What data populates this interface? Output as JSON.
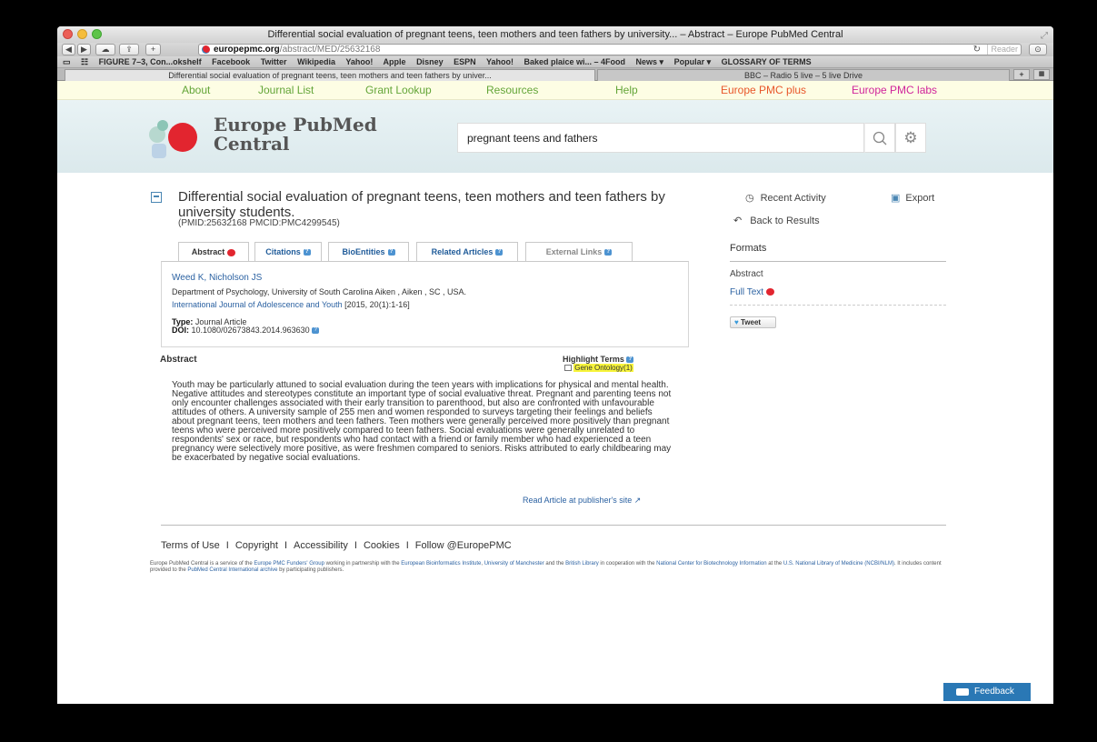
{
  "browser": {
    "window_title": "Differential social evaluation of pregnant teens, teen mothers and teen fathers by university... – Abstract – Europe PubMed Central",
    "url_host": "europepmc.org",
    "url_path": "/abstract/MED/25632168",
    "reader_label": "Reader",
    "bookmarks": [
      "FIGURE 7–3, Con...okshelf",
      "Facebook",
      "Twitter",
      "Wikipedia",
      "Yahoo!",
      "Apple",
      "Disney",
      "ESPN",
      "Yahoo!",
      "Baked plaice wi... – 4Food",
      "News ▾",
      "Popular ▾",
      "GLOSSARY OF TERMS"
    ],
    "tabs": [
      {
        "label": "Differential social evaluation of pregnant teens, teen mothers and teen fathers by univer..."
      },
      {
        "label": "BBC – Radio 5 live – 5 live Drive"
      }
    ]
  },
  "nav": {
    "about": "About",
    "journal_list": "Journal List",
    "grant_lookup": "Grant Lookup",
    "resources": "Resources",
    "help": "Help",
    "pmc_plus": "Europe PMC plus",
    "pmc_labs": "Europe PMC labs"
  },
  "brand": {
    "line1": "Europe PubMed",
    "line2": "Central"
  },
  "search": {
    "value": "pregnant teens and fathers"
  },
  "article": {
    "title": "Differential social evaluation of pregnant teens, teen mothers and teen fathers by university students.",
    "ids": "(PMID:25632168 PMCID:PMC4299545)",
    "tabs": {
      "abstract": "Abstract",
      "citations": "Citations",
      "bioentities": "BioEntities",
      "related": "Related Articles",
      "external": "External Links"
    },
    "authors": "Weed K, Nicholson JS",
    "affiliation": "Department of Psychology, University of South Carolina Aiken , Aiken , SC , USA.",
    "journal": "International Journal of Adolescence and Youth",
    "journal_ref": " [2015, 20(1):1-16]",
    "type_label": "Type:",
    "type_value": " Journal Article",
    "doi_label": "DOI:",
    "doi_value": " 10.1080/02673843.2014.963630",
    "abstract_heading": "Abstract",
    "highlight_terms": "Highlight Terms",
    "gene_ontology": "Gene Ontology(1)",
    "abstract_text": "Youth may be particularly attuned to social evaluation during the teen years with implications for physical and mental health. Negative attitudes and stereotypes constitute an important type of social evaluative threat. Pregnant and parenting teens not only encounter challenges associated with their early transition to parenthood, but also are confronted with unfavourable attitudes of others. A university sample of 255 men and women responded to surveys targeting their feelings and beliefs about pregnant teens, teen mothers and teen fathers. Teen mothers were generally perceived more positively than pregnant teens who were perceived more positively compared to teen fathers. Social evaluations were generally unrelated to respondents' sex or race, but respondents who had contact with a friend or family member who had experienced a teen pregnancy were selectively more positive, as were freshmen compared to seniors. Risks attributed to early childbearing may be exacerbated by negative social evaluations.",
    "read_link": "Read Article at publisher's site"
  },
  "sidebar": {
    "recent_activity": "Recent Activity",
    "export": "Export",
    "back": "Back to Results",
    "formats": "Formats",
    "format_abstract": "Abstract",
    "format_full": "Full Text",
    "tweet": "Tweet"
  },
  "footer": {
    "terms": "Terms of Use",
    "copyright": "Copyright",
    "accessibility": "Accessibility",
    "cookies": "Cookies",
    "follow": "Follow @EuropePMC",
    "sep": "I",
    "t1": "Europe PubMed Central is a service of the ",
    "a1": "Europe PMC Funders' Group",
    "t2": " working in partnership with the ",
    "a2": "European Bioinformatics Institute",
    "t3": ", ",
    "a3": "University of Manchester",
    "t4": " and the ",
    "a4": "British Library",
    "t5": " in cooperation with the ",
    "a5": "National Center for Biotechnology Information",
    "t6": " at the ",
    "a6": "U.S. National Library of Medicine (NCBI/NLM)",
    "t7": ". It includes content provided to the ",
    "a7": "PubMed Central International archive",
    "t8": " by participating publishers."
  },
  "feedback": "Feedback",
  "colors": {
    "nav_green": "#63a538",
    "nav_red": "#e8562a",
    "nav_pink": "#d0249b",
    "link_blue": "#2c62a2",
    "brand_red": "#e2252f",
    "feedback_blue": "#2a78b5"
  }
}
